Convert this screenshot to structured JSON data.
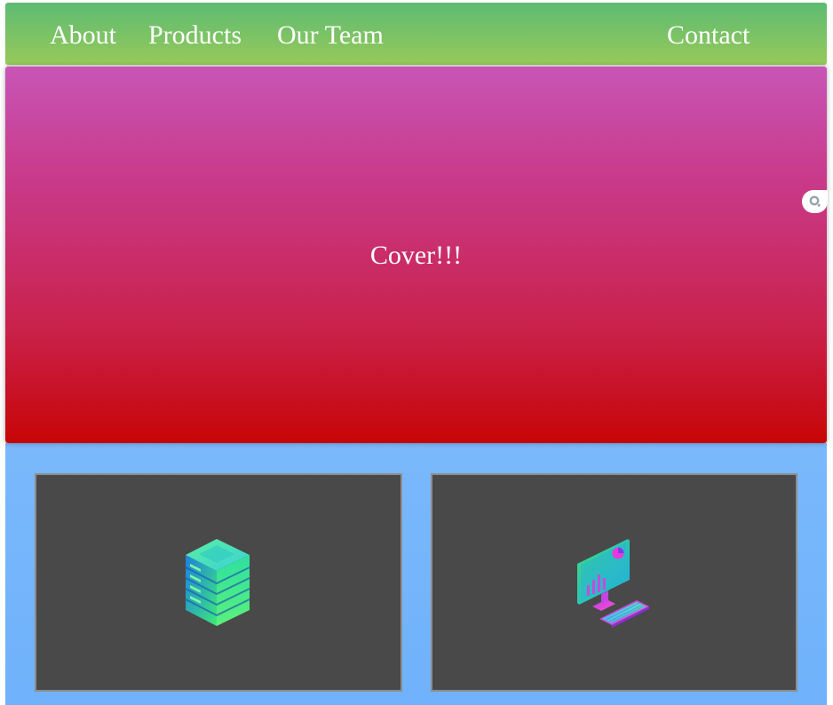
{
  "nav": {
    "about": "About",
    "products": "Products",
    "team": "Our Team",
    "contact": "Contact"
  },
  "cover": {
    "title": "Cover!!!"
  },
  "cards": [
    {
      "icon": "server-stack-icon"
    },
    {
      "icon": "computer-dashboard-icon"
    }
  ],
  "colors": {
    "nav_top": "#5dbb72",
    "nav_bottom": "#97c95a",
    "cover_top": "#c855b6",
    "cover_bottom": "#c80507",
    "section_bg": "#7ab8fb",
    "card_bg": "#494949"
  }
}
